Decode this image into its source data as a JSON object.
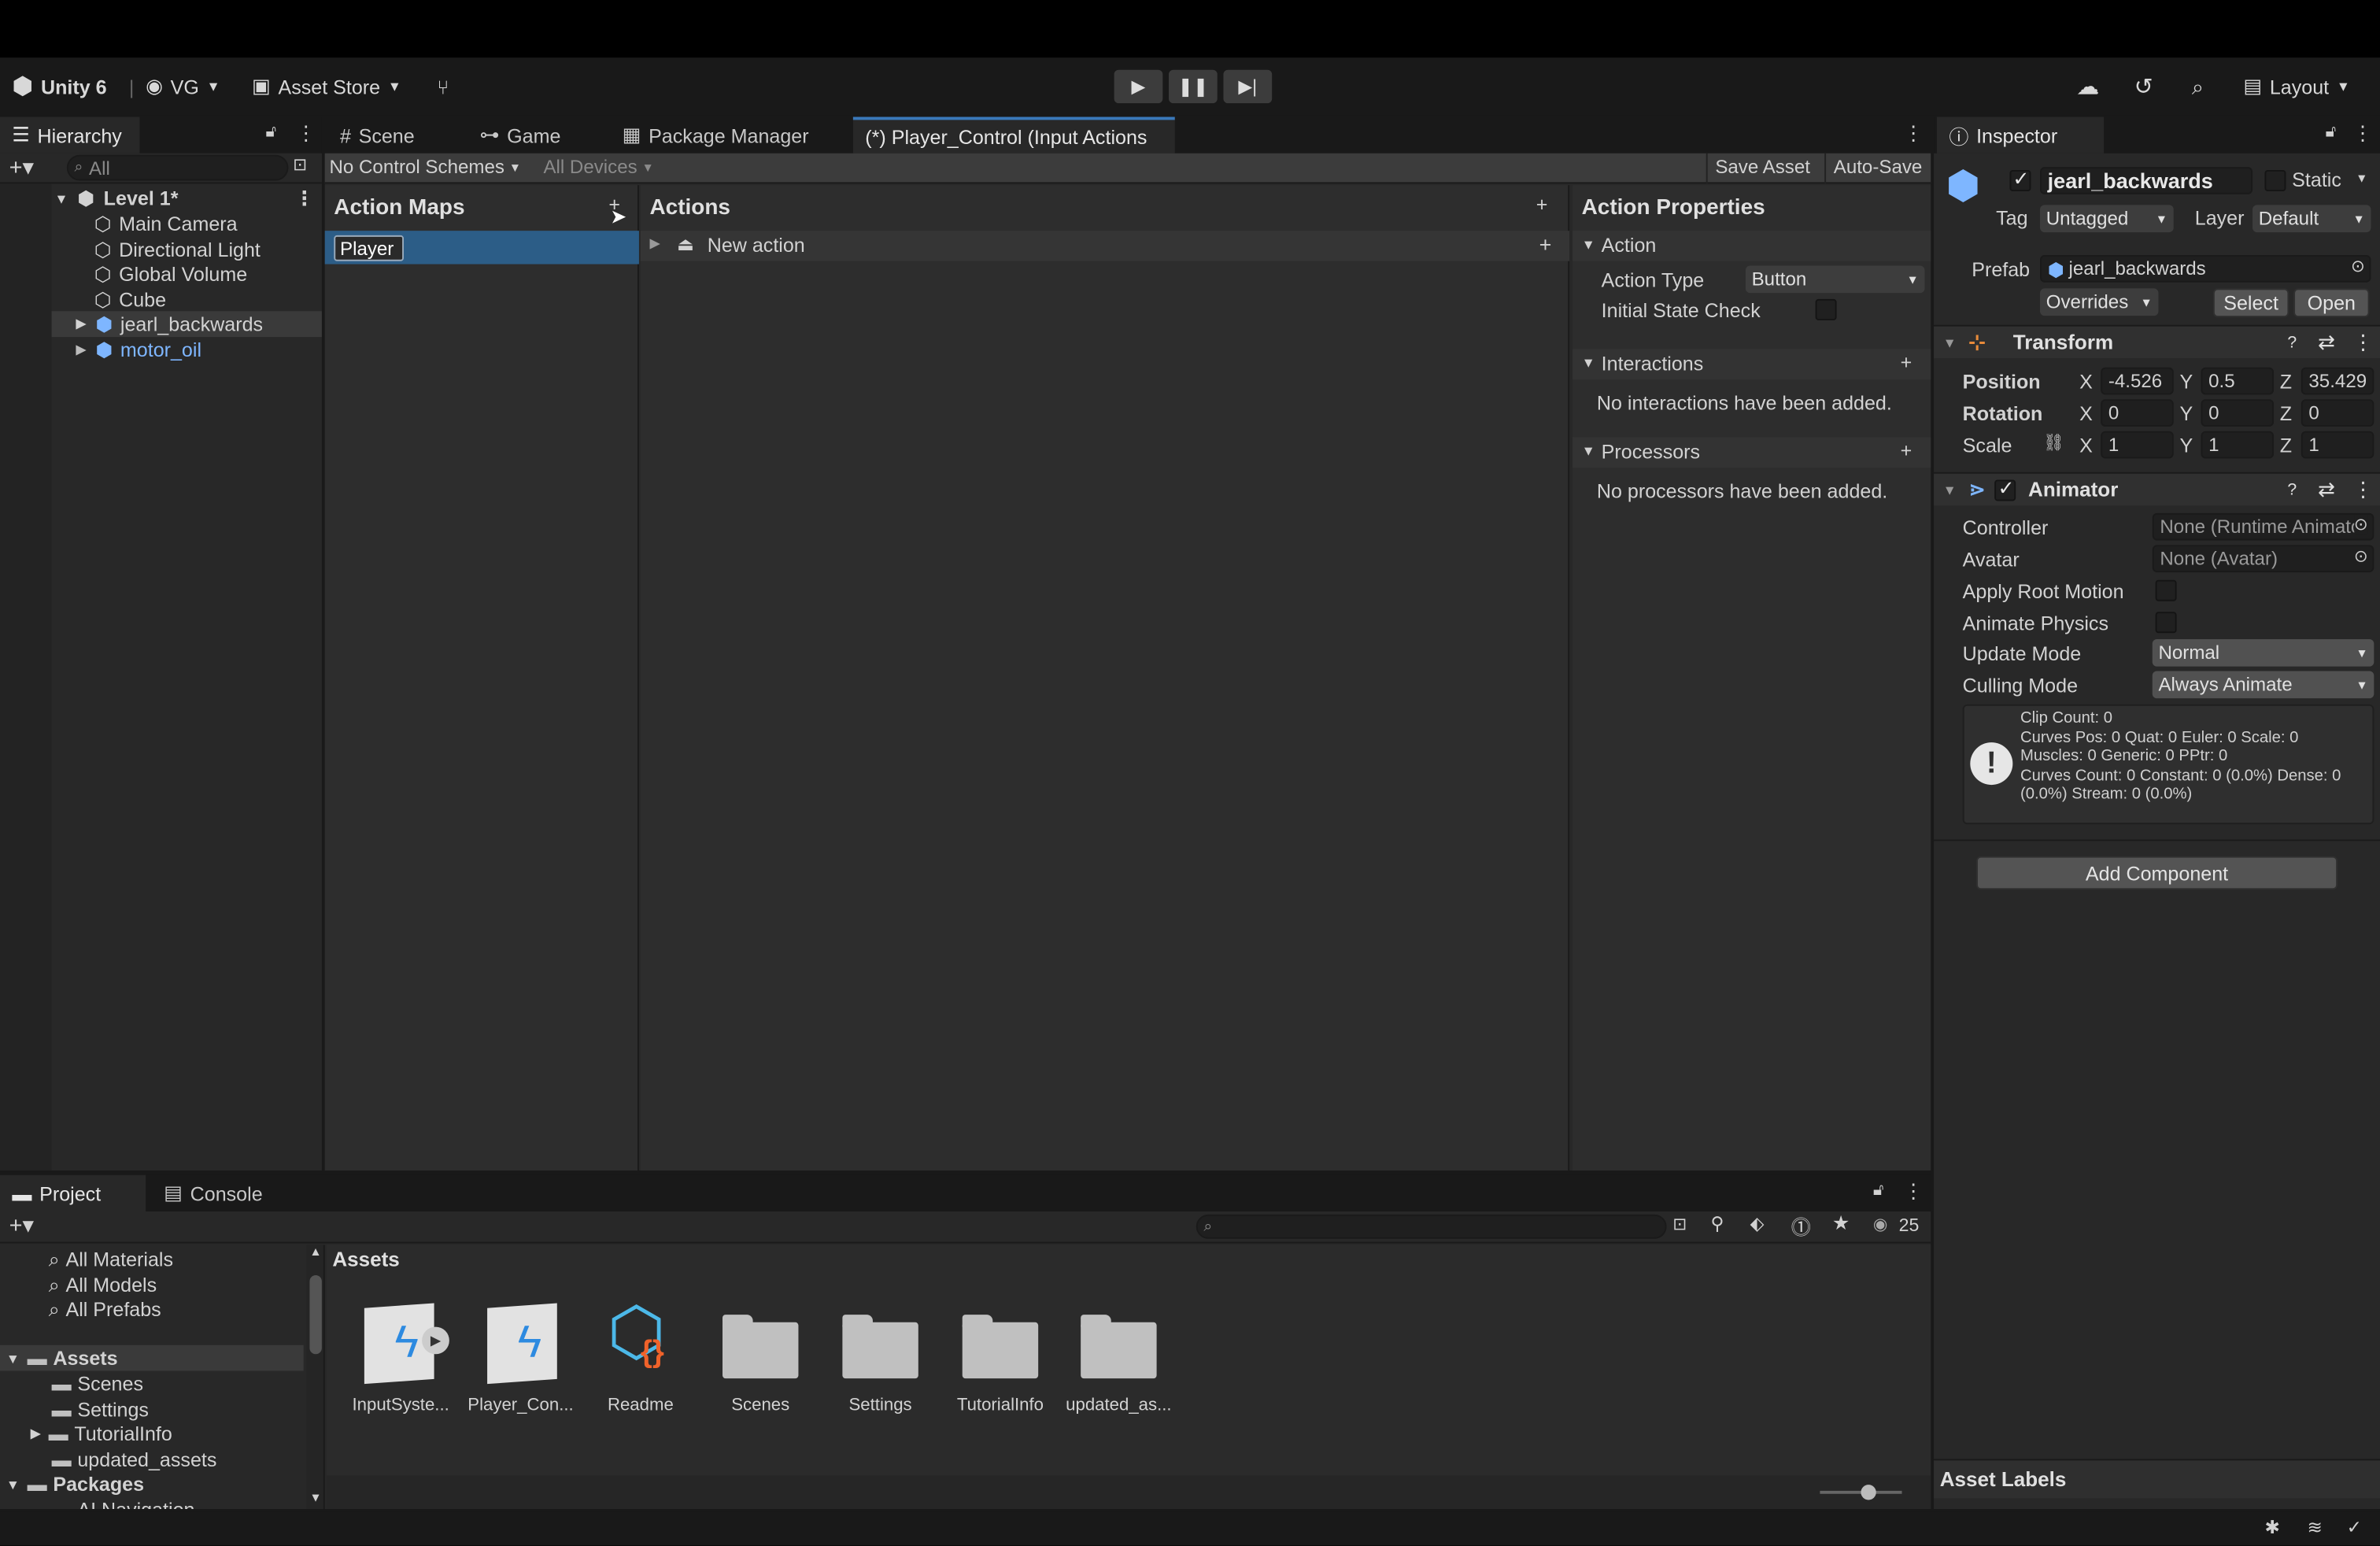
{
  "toolbar": {
    "product": "Unity 6",
    "account": "VG",
    "asset_store": "Asset Store",
    "layout": "Layout"
  },
  "hierarchy": {
    "tab": "Hierarchy",
    "search_placeholder": "All",
    "scene": "Level 1*",
    "items": [
      "Main Camera",
      "Directional Light",
      "Global Volume",
      "Cube",
      "jearl_backwards",
      "motor_oil"
    ]
  },
  "center_tabs": [
    "Scene",
    "Game",
    "Package Manager",
    "(*) Player_Control (Input Actions"
  ],
  "input_editor": {
    "control_schemes": "No Control Schemes",
    "devices": "All Devices",
    "save_asset": "Save Asset",
    "auto_save": "Auto-Save",
    "action_maps_title": "Action Maps",
    "action_map_value": "Player",
    "actions_title": "Actions",
    "new_action": "New action",
    "properties_title": "Action Properties",
    "action_section": "Action",
    "action_type_label": "Action Type",
    "action_type_value": "Button",
    "initial_state_label": "Initial State Check",
    "interactions_section": "Interactions",
    "interactions_empty": "No interactions have been added.",
    "processors_section": "Processors",
    "processors_empty": "No processors have been added."
  },
  "inspector": {
    "tab": "Inspector",
    "object_name": "jearl_backwards",
    "static_label": "Static",
    "tag_label": "Tag",
    "tag_value": "Untagged",
    "layer_label": "Layer",
    "layer_value": "Default",
    "prefab_label": "Prefab",
    "prefab_value": "jearl_backwards",
    "overrides": "Overrides",
    "select": "Select",
    "open": "Open",
    "transform": {
      "title": "Transform",
      "position_label": "Position",
      "rotation_label": "Rotation",
      "scale_label": "Scale",
      "axis_x": "X",
      "axis_y": "Y",
      "axis_z": "Z",
      "position": [
        "-4.526",
        "0.5",
        "35.429"
      ],
      "rotation": [
        "0",
        "0",
        "0"
      ],
      "scale": [
        "1",
        "1",
        "1"
      ]
    },
    "animator": {
      "title": "Animator",
      "controller_label": "Controller",
      "controller_value": "None (Runtime Animator Controller)",
      "avatar_label": "Avatar",
      "avatar_value": "None (Avatar)",
      "apply_root_motion": "Apply Root Motion",
      "animate_physics": "Animate Physics",
      "update_mode_label": "Update Mode",
      "update_mode_value": "Normal",
      "culling_mode_label": "Culling Mode",
      "culling_mode_value": "Always Animate",
      "info": [
        "Clip Count: 0",
        "Curves Pos: 0 Quat: 0 Euler: 0 Scale: 0",
        "Muscles: 0 Generic: 0 PPtr: 0",
        "Curves Count: 0 Constant: 0 (0.0%) Dense: 0",
        "(0.0%) Stream: 0 (0.0%)"
      ]
    },
    "add_component": "Add Component",
    "asset_labels": "Asset Labels"
  },
  "project": {
    "tabs": [
      "Project",
      "Console"
    ],
    "hidden_count": "25",
    "favorites": [
      "All Materials",
      "All Models",
      "All Prefabs"
    ],
    "assets_root": "Assets",
    "asset_folders": [
      "Scenes",
      "Settings",
      "TutorialInfo",
      "updated_assets"
    ],
    "packages_root": "Packages",
    "packages_partial": "AI Navigation",
    "breadcrumb": "Assets",
    "grid": [
      "InputSyste...",
      "Player_Con...",
      "Readme",
      "Scenes",
      "Settings",
      "TutorialInfo",
      "updated_as..."
    ]
  },
  "colors": {
    "accent": "#2c5d87",
    "link_blue": "#7eb6ff",
    "panel": "#282828",
    "header": "#191919"
  }
}
